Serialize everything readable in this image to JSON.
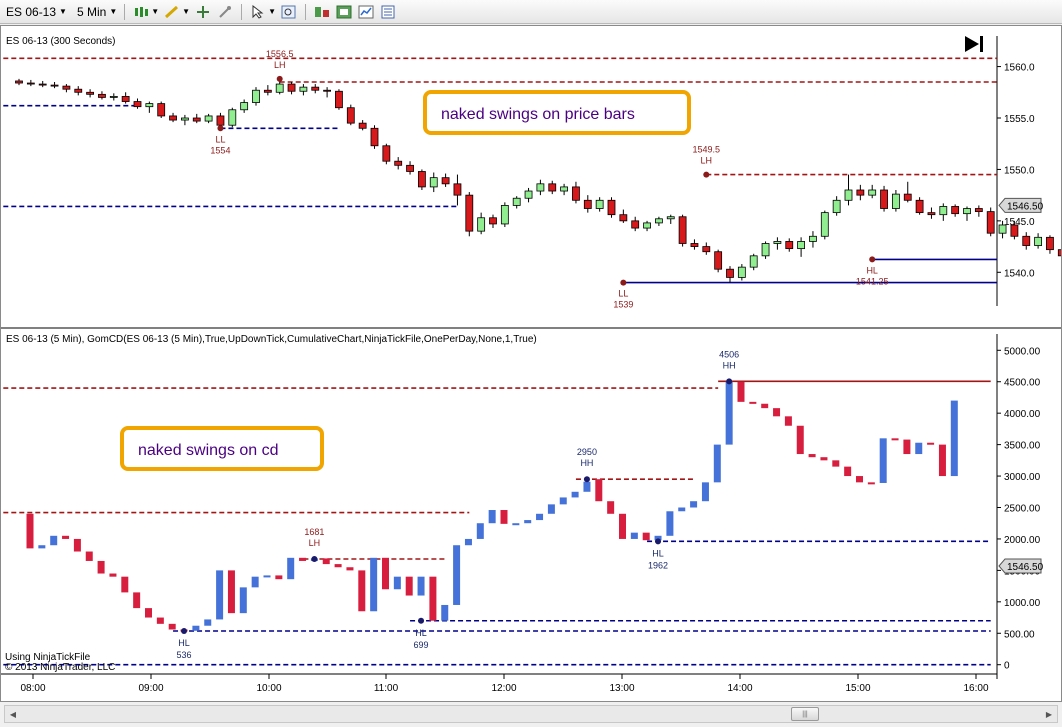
{
  "toolbar": {
    "instrument": "ES 06-13",
    "interval": "5 Min",
    "icons": [
      "candlestick-icon",
      "pencil-icon",
      "crosshair-icon",
      "pin-icon",
      "pointer-icon",
      "zoom-icon",
      "indicator-icon",
      "strategy-icon",
      "chart-style-icon",
      "properties-icon"
    ]
  },
  "colors": {
    "up_candle": "#90ee90",
    "down_candle": "#d7191c",
    "red_line": "#a31515",
    "blue_line": "#00008b",
    "cd_up": "#4472d8",
    "cd_down": "#d81e3f",
    "callout_border": "#f0a500"
  },
  "price_panel": {
    "title": "ES 06-13 (300 Seconds)",
    "ymin": 1537.5,
    "ymax": 1562,
    "axis": {
      "ticks": [
        "1540.0",
        "1545.0",
        "1550.0",
        "1555.0",
        "1560.0"
      ],
      "ticks_v": [
        1540,
        1545,
        1550,
        1555,
        1560
      ]
    },
    "last_price": "1546.50",
    "callout": "naked swings on price bars",
    "swing_labels": [
      {
        "text": "1556.5",
        "v": 1558.8,
        "i": 22,
        "side": "above"
      },
      {
        "text": "LH",
        "v": 1558.8,
        "i": 22,
        "side": "above2"
      },
      {
        "text": "LL",
        "v": 1554,
        "i": 17,
        "side": "below"
      },
      {
        "text": "1554",
        "v": 1554,
        "i": 17,
        "side": "below2"
      },
      {
        "text": "1549.5",
        "v": 1549.5,
        "i": 58,
        "side": "above"
      },
      {
        "text": "LH",
        "v": 1549.5,
        "i": 58,
        "side": "above2"
      },
      {
        "text": "LL",
        "v": 1539,
        "i": 51,
        "side": "below"
      },
      {
        "text": "1539",
        "v": 1539,
        "i": 51,
        "side": "below2"
      },
      {
        "text": "HL",
        "v": 1541.25,
        "i": 72,
        "side": "below"
      },
      {
        "text": "1541.25",
        "v": 1541.25,
        "i": 72,
        "side": "below2"
      }
    ],
    "candles": [
      {
        "o": 1558.6,
        "h": 1558.8,
        "l": 1558.2,
        "c": 1558.4
      },
      {
        "o": 1558.4,
        "h": 1558.7,
        "l": 1558.1,
        "c": 1558.3
      },
      {
        "o": 1558.3,
        "h": 1558.6,
        "l": 1558.0,
        "c": 1558.2
      },
      {
        "o": 1558.2,
        "h": 1558.5,
        "l": 1557.9,
        "c": 1558.1
      },
      {
        "o": 1558.1,
        "h": 1558.3,
        "l": 1557.5,
        "c": 1557.8
      },
      {
        "o": 1557.8,
        "h": 1558.1,
        "l": 1557.2,
        "c": 1557.5
      },
      {
        "o": 1557.5,
        "h": 1557.8,
        "l": 1557.0,
        "c": 1557.3
      },
      {
        "o": 1557.3,
        "h": 1557.6,
        "l": 1556.8,
        "c": 1557.0
      },
      {
        "o": 1557.0,
        "h": 1557.4,
        "l": 1556.7,
        "c": 1557.1
      },
      {
        "o": 1557.1,
        "h": 1557.5,
        "l": 1556.4,
        "c": 1556.6
      },
      {
        "o": 1556.6,
        "h": 1556.9,
        "l": 1555.9,
        "c": 1556.1
      },
      {
        "o": 1556.1,
        "h": 1556.6,
        "l": 1555.5,
        "c": 1556.4
      },
      {
        "o": 1556.4,
        "h": 1556.6,
        "l": 1555.0,
        "c": 1555.2
      },
      {
        "o": 1555.2,
        "h": 1555.5,
        "l": 1554.6,
        "c": 1554.8
      },
      {
        "o": 1554.8,
        "h": 1555.3,
        "l": 1554.3,
        "c": 1555.0
      },
      {
        "o": 1555.0,
        "h": 1555.4,
        "l": 1554.5,
        "c": 1554.7
      },
      {
        "o": 1554.7,
        "h": 1555.4,
        "l": 1554.5,
        "c": 1555.2
      },
      {
        "o": 1555.2,
        "h": 1555.5,
        "l": 1554.0,
        "c": 1554.3
      },
      {
        "o": 1554.3,
        "h": 1556.0,
        "l": 1554.1,
        "c": 1555.8
      },
      {
        "o": 1555.8,
        "h": 1556.8,
        "l": 1555.5,
        "c": 1556.5
      },
      {
        "o": 1556.5,
        "h": 1558.0,
        "l": 1556.2,
        "c": 1557.7
      },
      {
        "o": 1557.7,
        "h": 1558.2,
        "l": 1557.2,
        "c": 1557.5
      },
      {
        "o": 1557.5,
        "h": 1558.8,
        "l": 1557.3,
        "c": 1558.3
      },
      {
        "o": 1558.3,
        "h": 1558.5,
        "l": 1557.3,
        "c": 1557.6
      },
      {
        "o": 1557.6,
        "h": 1558.3,
        "l": 1557.2,
        "c": 1558.0
      },
      {
        "o": 1558.0,
        "h": 1558.3,
        "l": 1557.4,
        "c": 1557.7
      },
      {
        "o": 1557.7,
        "h": 1558.0,
        "l": 1557.0,
        "c": 1557.6
      },
      {
        "o": 1557.6,
        "h": 1557.8,
        "l": 1555.8,
        "c": 1556.0
      },
      {
        "o": 1556.0,
        "h": 1556.3,
        "l": 1554.3,
        "c": 1554.5
      },
      {
        "o": 1554.5,
        "h": 1554.8,
        "l": 1553.8,
        "c": 1554.0
      },
      {
        "o": 1554.0,
        "h": 1554.3,
        "l": 1552.0,
        "c": 1552.3
      },
      {
        "o": 1552.3,
        "h": 1552.5,
        "l": 1550.5,
        "c": 1550.8
      },
      {
        "o": 1550.8,
        "h": 1551.2,
        "l": 1550.0,
        "c": 1550.4
      },
      {
        "o": 1550.4,
        "h": 1550.8,
        "l": 1549.5,
        "c": 1549.8
      },
      {
        "o": 1549.8,
        "h": 1550.0,
        "l": 1548.0,
        "c": 1548.3
      },
      {
        "o": 1548.3,
        "h": 1549.7,
        "l": 1547.8,
        "c": 1549.2
      },
      {
        "o": 1549.2,
        "h": 1549.6,
        "l": 1548.3,
        "c": 1548.6
      },
      {
        "o": 1548.6,
        "h": 1549.5,
        "l": 1546.5,
        "c": 1547.5
      },
      {
        "o": 1547.5,
        "h": 1547.8,
        "l": 1543.5,
        "c": 1544.0
      },
      {
        "o": 1544.0,
        "h": 1545.8,
        "l": 1543.7,
        "c": 1545.3
      },
      {
        "o": 1545.3,
        "h": 1545.6,
        "l": 1544.3,
        "c": 1544.7
      },
      {
        "o": 1544.7,
        "h": 1546.8,
        "l": 1544.4,
        "c": 1546.5
      },
      {
        "o": 1546.5,
        "h": 1547.4,
        "l": 1546.2,
        "c": 1547.2
      },
      {
        "o": 1547.2,
        "h": 1548.2,
        "l": 1546.8,
        "c": 1547.9
      },
      {
        "o": 1547.9,
        "h": 1549.0,
        "l": 1547.5,
        "c": 1548.6
      },
      {
        "o": 1548.6,
        "h": 1548.9,
        "l": 1547.6,
        "c": 1547.9
      },
      {
        "o": 1547.9,
        "h": 1548.6,
        "l": 1547.5,
        "c": 1548.3
      },
      {
        "o": 1548.3,
        "h": 1548.8,
        "l": 1546.7,
        "c": 1547.0
      },
      {
        "o": 1547.0,
        "h": 1547.5,
        "l": 1545.8,
        "c": 1546.2
      },
      {
        "o": 1546.2,
        "h": 1547.3,
        "l": 1545.9,
        "c": 1547.0
      },
      {
        "o": 1547.0,
        "h": 1547.3,
        "l": 1545.3,
        "c": 1545.6
      },
      {
        "o": 1545.6,
        "h": 1546.1,
        "l": 1544.8,
        "c": 1545.0
      },
      {
        "o": 1545.0,
        "h": 1545.4,
        "l": 1544.0,
        "c": 1544.3
      },
      {
        "o": 1544.3,
        "h": 1545.0,
        "l": 1544.0,
        "c": 1544.8
      },
      {
        "o": 1544.8,
        "h": 1545.4,
        "l": 1544.5,
        "c": 1545.2
      },
      {
        "o": 1545.2,
        "h": 1545.6,
        "l": 1544.7,
        "c": 1545.4
      },
      {
        "o": 1545.4,
        "h": 1545.6,
        "l": 1542.5,
        "c": 1542.8
      },
      {
        "o": 1542.8,
        "h": 1543.2,
        "l": 1542.2,
        "c": 1542.5
      },
      {
        "o": 1542.5,
        "h": 1542.9,
        "l": 1541.7,
        "c": 1542.0
      },
      {
        "o": 1542.0,
        "h": 1542.2,
        "l": 1540.0,
        "c": 1540.3
      },
      {
        "o": 1540.3,
        "h": 1540.6,
        "l": 1539.0,
        "c": 1539.5
      },
      {
        "o": 1539.5,
        "h": 1540.8,
        "l": 1539.2,
        "c": 1540.5
      },
      {
        "o": 1540.5,
        "h": 1541.8,
        "l": 1540.2,
        "c": 1541.6
      },
      {
        "o": 1541.6,
        "h": 1543.0,
        "l": 1541.3,
        "c": 1542.8
      },
      {
        "o": 1542.8,
        "h": 1543.4,
        "l": 1542.2,
        "c": 1543.0
      },
      {
        "o": 1543.0,
        "h": 1543.3,
        "l": 1542.0,
        "c": 1542.3
      },
      {
        "o": 1542.3,
        "h": 1543.4,
        "l": 1541.5,
        "c": 1543.0
      },
      {
        "o": 1543.0,
        "h": 1544.0,
        "l": 1542.4,
        "c": 1543.5
      },
      {
        "o": 1543.5,
        "h": 1546.0,
        "l": 1543.2,
        "c": 1545.8
      },
      {
        "o": 1545.8,
        "h": 1547.4,
        "l": 1545.5,
        "c": 1547.0
      },
      {
        "o": 1547.0,
        "h": 1549.5,
        "l": 1546.5,
        "c": 1548.0
      },
      {
        "o": 1548.0,
        "h": 1548.5,
        "l": 1547.0,
        "c": 1547.5
      },
      {
        "o": 1547.5,
        "h": 1548.5,
        "l": 1547.2,
        "c": 1548.0
      },
      {
        "o": 1548.0,
        "h": 1548.4,
        "l": 1545.9,
        "c": 1546.2
      },
      {
        "o": 1546.2,
        "h": 1548.0,
        "l": 1545.9,
        "c": 1547.6
      },
      {
        "o": 1547.6,
        "h": 1548.8,
        "l": 1546.8,
        "c": 1547.0
      },
      {
        "o": 1547.0,
        "h": 1547.3,
        "l": 1545.6,
        "c": 1545.8
      },
      {
        "o": 1545.8,
        "h": 1546.3,
        "l": 1545.2,
        "c": 1545.6
      },
      {
        "o": 1545.6,
        "h": 1546.7,
        "l": 1545.0,
        "c": 1546.4
      },
      {
        "o": 1546.4,
        "h": 1546.6,
        "l": 1545.4,
        "c": 1545.7
      },
      {
        "o": 1545.7,
        "h": 1546.4,
        "l": 1545.0,
        "c": 1546.2
      },
      {
        "o": 1546.2,
        "h": 1546.5,
        "l": 1545.4,
        "c": 1545.9
      },
      {
        "o": 1545.9,
        "h": 1546.3,
        "l": 1543.5,
        "c": 1543.8
      },
      {
        "o": 1543.8,
        "h": 1545.0,
        "l": 1543.3,
        "c": 1544.6
      },
      {
        "o": 1544.6,
        "h": 1545.0,
        "l": 1543.2,
        "c": 1543.5
      },
      {
        "o": 1543.5,
        "h": 1543.9,
        "l": 1542.2,
        "c": 1542.6
      },
      {
        "o": 1542.6,
        "h": 1543.8,
        "l": 1542.3,
        "c": 1543.4
      },
      {
        "o": 1543.4,
        "h": 1543.6,
        "l": 1541.8,
        "c": 1542.2
      },
      {
        "o": 1542.2,
        "h": 1542.7,
        "l": 1541.2,
        "c": 1541.6
      },
      {
        "o": 1541.6,
        "h": 1542.8,
        "l": 1541.4,
        "c": 1542.5
      },
      {
        "o": 1542.5,
        "h": 1543.8,
        "l": 1542.3,
        "c": 1543.5
      },
      {
        "o": 1543.5,
        "h": 1544.5,
        "l": 1543.0,
        "c": 1544.2
      },
      {
        "o": 1544.2,
        "h": 1544.7,
        "l": 1542.8,
        "c": 1543.0
      },
      {
        "o": 1543.0,
        "h": 1546.0,
        "l": 1542.0,
        "c": 1545.5
      },
      {
        "o": 1545.5,
        "h": 1546.2,
        "l": 1545.0,
        "c": 1545.9
      },
      {
        "o": 1545.9,
        "h": 1547.8,
        "l": 1545.6,
        "c": 1547.2
      }
    ],
    "lines": [
      {
        "color": "red",
        "dash": true,
        "v": 1560.8,
        "i0": -2,
        "i1": 98
      },
      {
        "color": "red",
        "dash": true,
        "v": 1558.5,
        "i0": 22,
        "i1": 98
      },
      {
        "color": "red",
        "dash": true,
        "v": 1549.5,
        "i0": 58,
        "i1": 98
      },
      {
        "color": "blue",
        "dash": true,
        "v": 1556.2,
        "i0": -2,
        "i1": 10
      },
      {
        "color": "blue",
        "dash": true,
        "v": 1554.0,
        "i0": 17,
        "i1": 27
      },
      {
        "color": "blue",
        "dash": true,
        "v": 1546.4,
        "i0": -2,
        "i1": 37
      },
      {
        "color": "blue",
        "dash": false,
        "v": 1539.0,
        "i0": 51,
        "i1": 98
      },
      {
        "color": "blue",
        "dash": false,
        "v": 1541.25,
        "i0": 72,
        "i1": 98
      }
    ]
  },
  "cd_panel": {
    "title": "ES 06-13 (5 Min), GomCD(ES 06-13 (5 Min),True,UpDownTick,CumulativeChart,NinjaTickFile,OnePerDay,None,1,True)",
    "ymin": -100,
    "ymax": 5100,
    "axis": {
      "ticks": [
        "0",
        "500.00",
        "1000.00",
        "1500.00",
        "2000.00",
        "2500.00",
        "3000.00",
        "3500.00",
        "4000.00",
        "4500.00",
        "5000.00"
      ],
      "ticks_v": [
        0,
        500,
        1000,
        1500,
        2000,
        2500,
        3000,
        3500,
        4000,
        4500,
        5000
      ]
    },
    "last_price": "1546.50",
    "callout": "naked swings on cd",
    "footer_line1": "Using NinjaTickFile",
    "footer_line2": "© 2013 NinjaTrader, LLC",
    "swing_labels": [
      {
        "text": "1681",
        "v": 1681,
        "i": 24,
        "side": "above"
      },
      {
        "text": "LH",
        "v": 1681,
        "i": 24,
        "side": "above2"
      },
      {
        "text": "2950",
        "v": 2950,
        "i": 47,
        "side": "above"
      },
      {
        "text": "HH",
        "v": 2950,
        "i": 47,
        "side": "above2"
      },
      {
        "text": "4506",
        "v": 4506,
        "i": 59,
        "side": "above"
      },
      {
        "text": "HH",
        "v": 4506,
        "i": 59,
        "side": "above2"
      },
      {
        "text": "HL",
        "v": 536,
        "i": 13,
        "side": "below"
      },
      {
        "text": "536",
        "v": 536,
        "i": 13,
        "side": "below2"
      },
      {
        "text": "HL",
        "v": 699,
        "i": 33,
        "side": "below"
      },
      {
        "text": "699",
        "v": 699,
        "i": 33,
        "side": "below2"
      },
      {
        "text": "HL",
        "v": 1962,
        "i": 53,
        "side": "below"
      },
      {
        "text": "1962",
        "v": 1962,
        "i": 53,
        "side": "below2"
      }
    ],
    "bars": [
      [
        2400,
        1850
      ],
      [
        1850,
        1900
      ],
      [
        1900,
        2050
      ],
      [
        2050,
        2000
      ],
      [
        2000,
        1800
      ],
      [
        1800,
        1650
      ],
      [
        1650,
        1450
      ],
      [
        1450,
        1400
      ],
      [
        1400,
        1150
      ],
      [
        1150,
        900
      ],
      [
        900,
        750
      ],
      [
        750,
        650
      ],
      [
        650,
        560
      ],
      [
        560,
        540
      ],
      [
        540,
        620
      ],
      [
        620,
        720
      ],
      [
        720,
        1500
      ],
      [
        1500,
        820
      ],
      [
        820,
        1230
      ],
      [
        1230,
        1400
      ],
      [
        1400,
        1420
      ],
      [
        1420,
        1360
      ],
      [
        1360,
        1700
      ],
      [
        1700,
        1650
      ],
      [
        1650,
        1690
      ],
      [
        1690,
        1600
      ],
      [
        1600,
        1550
      ],
      [
        1550,
        1500
      ],
      [
        1500,
        850
      ],
      [
        850,
        1700
      ],
      [
        1700,
        1200
      ],
      [
        1200,
        1400
      ],
      [
        1400,
        1100
      ],
      [
        1100,
        1400
      ],
      [
        1400,
        700
      ],
      [
        700,
        950
      ],
      [
        950,
        1900
      ],
      [
        1900,
        2000
      ],
      [
        2000,
        2250
      ],
      [
        2250,
        2460
      ],
      [
        2460,
        2240
      ],
      [
        2240,
        2250
      ],
      [
        2250,
        2300
      ],
      [
        2300,
        2400
      ],
      [
        2400,
        2550
      ],
      [
        2550,
        2660
      ],
      [
        2660,
        2750
      ],
      [
        2750,
        2910
      ],
      [
        2950,
        2600
      ],
      [
        2600,
        2400
      ],
      [
        2400,
        2000
      ],
      [
        2000,
        2100
      ],
      [
        2100,
        1980
      ],
      [
        1980,
        2050
      ],
      [
        2050,
        2440
      ],
      [
        2440,
        2500
      ],
      [
        2500,
        2600
      ],
      [
        2600,
        2900
      ],
      [
        2900,
        3500
      ],
      [
        3500,
        4500
      ],
      [
        4500,
        4180
      ],
      [
        4180,
        4150
      ],
      [
        4150,
        4080
      ],
      [
        4080,
        3950
      ],
      [
        3950,
        3800
      ],
      [
        3800,
        3350
      ],
      [
        3350,
        3300
      ],
      [
        3300,
        3250
      ],
      [
        3250,
        3150
      ],
      [
        3150,
        3000
      ],
      [
        3000,
        2900
      ],
      [
        2900,
        2890
      ],
      [
        2890,
        3600
      ],
      [
        3600,
        3580
      ],
      [
        3580,
        3350
      ],
      [
        3350,
        3530
      ],
      [
        3530,
        3500
      ],
      [
        3500,
        3000
      ],
      [
        3000,
        4200
      ]
    ],
    "lines": [
      {
        "color": "red",
        "dash": true,
        "v": 4400,
        "i0": -2,
        "i1": 59
      },
      {
        "color": "red",
        "dash": false,
        "v": 4506,
        "i0": 59,
        "i1": 82
      },
      {
        "color": "red",
        "dash": true,
        "v": 2420,
        "i0": -2,
        "i1": 38
      },
      {
        "color": "red",
        "dash": true,
        "v": 2950,
        "i0": 47,
        "i1": 57
      },
      {
        "color": "red",
        "dash": true,
        "v": 1681,
        "i0": 24,
        "i1": 36
      },
      {
        "color": "blue",
        "dash": true,
        "v": 1962,
        "i0": 53,
        "i1": 82
      },
      {
        "color": "blue",
        "dash": true,
        "v": 699,
        "i0": 33,
        "i1": 82
      },
      {
        "color": "blue",
        "dash": true,
        "v": 536,
        "i0": 13,
        "i1": 82
      },
      {
        "color": "blue",
        "dash": true,
        "v": 0,
        "i0": -2,
        "i1": 82
      }
    ]
  },
  "time_axis": {
    "labels": [
      "08:00",
      "09:00",
      "10:00",
      "11:00",
      "12:00",
      "13:00",
      "14:00",
      "15:00",
      "16:00"
    ]
  }
}
